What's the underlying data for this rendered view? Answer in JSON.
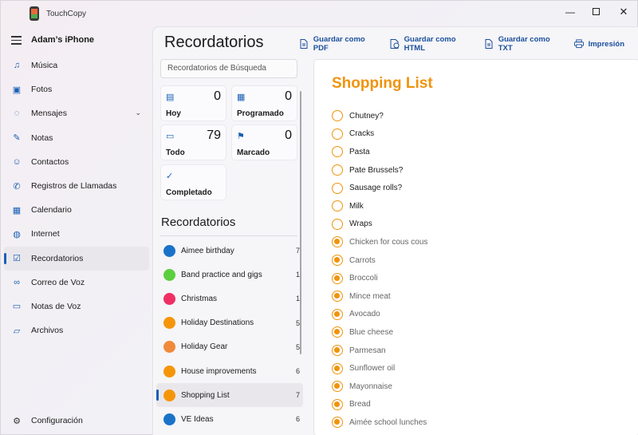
{
  "window": {
    "title": "TouchCopy",
    "min": "—",
    "max": "",
    "close": "✕"
  },
  "sidebar": {
    "device": "Adam’s iPhone",
    "items": [
      {
        "label": "Música",
        "icon": "music-icon",
        "glyph": "♫"
      },
      {
        "label": "Fotos",
        "icon": "photo-icon",
        "glyph": "▣"
      },
      {
        "label": "Mensajes",
        "icon": "message-icon",
        "glyph": "◌"
      },
      {
        "label": "Notas",
        "icon": "note-icon",
        "glyph": "✎"
      },
      {
        "label": "Contactos",
        "icon": "contact-icon",
        "glyph": "☺"
      },
      {
        "label": "Registros de Llamadas",
        "icon": "phone-icon",
        "glyph": "✆"
      },
      {
        "label": "Calendario",
        "icon": "calendar-icon",
        "glyph": "▦"
      },
      {
        "label": "Internet",
        "icon": "globe-icon",
        "glyph": "◍"
      },
      {
        "label": "Recordatorios",
        "icon": "reminder-icon",
        "glyph": "☑"
      },
      {
        "label": "Correo de Voz",
        "icon": "voicemail-icon",
        "glyph": "∞"
      },
      {
        "label": "Notas de Voz",
        "icon": "voice-memo-icon",
        "glyph": "▭"
      },
      {
        "label": "Archivos",
        "icon": "folder-icon",
        "glyph": "▱"
      }
    ],
    "active_index": 8,
    "settings": "Configuración",
    "settings_glyph": "⚙"
  },
  "main": {
    "title": "Recordatorios",
    "toolbar": {
      "pdf": "Guardar como PDF",
      "html": "Guardar como HTML",
      "txt": "Guardar como TXT",
      "print": "Impresión"
    },
    "search_placeholder": "Recordatorios de Búsqueda",
    "tiles": {
      "today": {
        "label": "Hoy",
        "count": "0",
        "glyph": "▤"
      },
      "scheduled": {
        "label": "Programado",
        "count": "0",
        "glyph": "▦"
      },
      "all": {
        "label": "Todo",
        "count": "79",
        "glyph": "▭"
      },
      "flagged": {
        "label": "Marcado",
        "count": "0",
        "glyph": "⚑"
      },
      "completed": {
        "label": "Completado",
        "glyph": "✓"
      }
    },
    "lists_heading": "Recordatorios",
    "lists": [
      {
        "label": "Aimee birthday",
        "count": "7",
        "color": "#1a73c9"
      },
      {
        "label": "Band practice and gigs",
        "count": "1",
        "color": "#5ccf3e"
      },
      {
        "label": "Christmas",
        "count": "1",
        "color": "#ef2f63"
      },
      {
        "label": "Holiday Destinations",
        "count": "5",
        "color": "#f5960a"
      },
      {
        "label": "Holiday Gear",
        "count": "5",
        "color": "#f08a3a"
      },
      {
        "label": "House improvements",
        "count": "6",
        "color": "#f5960a"
      },
      {
        "label": "Shopping List",
        "count": "7",
        "color": "#f5960a"
      },
      {
        "label": "VE Ideas",
        "count": "6",
        "color": "#1a73c9"
      }
    ],
    "active_list": 6
  },
  "detail": {
    "title": "Shopping List",
    "items": [
      {
        "label": "Chutney?",
        "done": false
      },
      {
        "label": "Cracks",
        "done": false
      },
      {
        "label": "Pasta",
        "done": false
      },
      {
        "label": "Pate Brussels?",
        "done": false
      },
      {
        "label": "Sausage rolls?",
        "done": false
      },
      {
        "label": "Milk",
        "done": false
      },
      {
        "label": "Wraps",
        "done": false
      },
      {
        "label": "Chicken for cous cous",
        "done": true
      },
      {
        "label": "Carrots",
        "done": true
      },
      {
        "label": "Broccoli",
        "done": true
      },
      {
        "label": "Mince meat",
        "done": true
      },
      {
        "label": "Avocado",
        "done": true
      },
      {
        "label": "Blue cheese",
        "done": true
      },
      {
        "label": "Parmesan",
        "done": true
      },
      {
        "label": "Sunflower oil",
        "done": true
      },
      {
        "label": "Mayonnaise",
        "done": true
      },
      {
        "label": "Bread",
        "done": true
      },
      {
        "label": "Aimée school lunches",
        "done": true
      }
    ]
  },
  "colors": {
    "accent": "#1a5fb4",
    "list_title": "#f0930c"
  }
}
